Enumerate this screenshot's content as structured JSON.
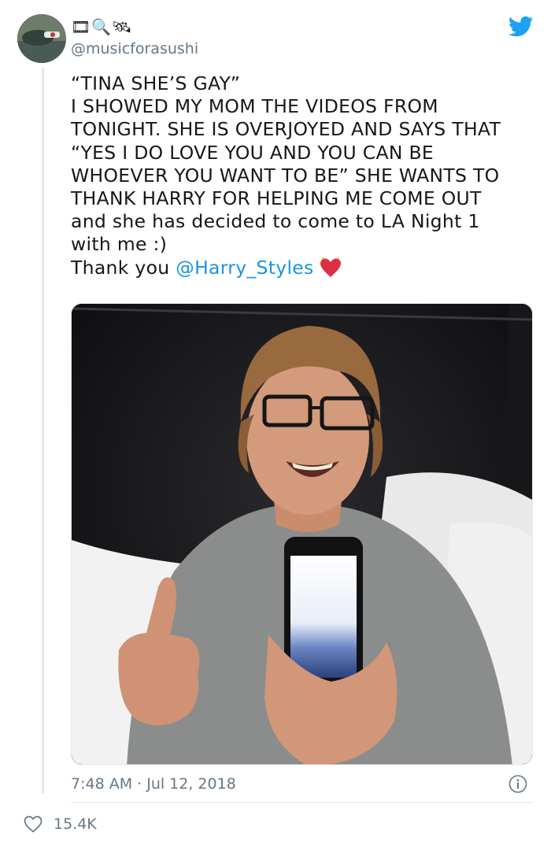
{
  "user": {
    "display_name": "🎞🔍🛰",
    "handle": "@musicforasushi"
  },
  "tweet": {
    "lines": [
      "“TINA SHE’S GAY”",
      "I SHOWED MY MOM THE VIDEOS FROM",
      "TONIGHT. SHE IS OVERJOYED AND SAYS THAT",
      "“YES I DO LOVE YOU AND YOU CAN BE",
      "WHOEVER YOU WANT TO BE” SHE WANTS TO",
      "THANK HARRY FOR HELPING ME COME OUT",
      "and she has decided to come to LA Night 1",
      "with me :)"
    ],
    "thanks_prefix": "Thank you ",
    "mention": "@Harry_Styles",
    "timestamp": "7:48 AM · Jul 12, 2018"
  },
  "stats": {
    "likes": "15.4K"
  },
  "icons": {
    "logo": "twitter-bird-icon",
    "info": "info-icon",
    "like": "heart-outline-icon",
    "emoji": "sparkling-heart-icon"
  },
  "colors": {
    "accent": "#1da1f2",
    "mention": "#1b95e0",
    "secondary_text": "#657786",
    "heart": "#e0245e"
  }
}
